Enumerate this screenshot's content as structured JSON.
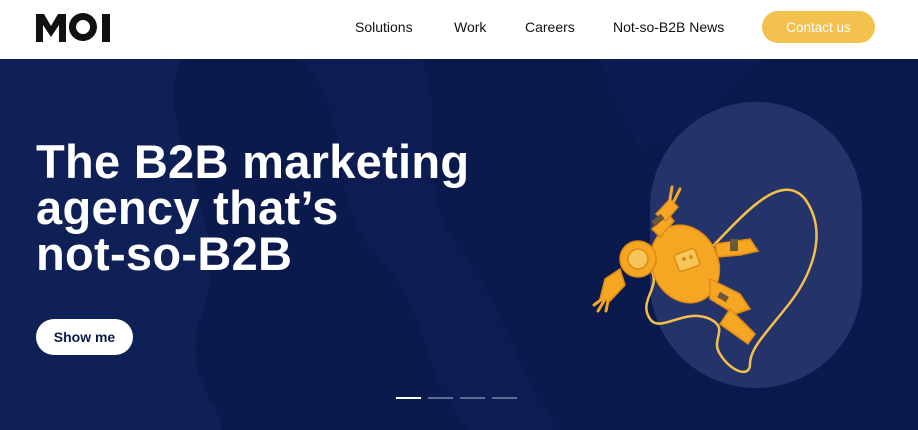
{
  "header": {
    "logo_text": "MOI",
    "nav": [
      "Solutions",
      "Work",
      "Careers",
      "Not-so-B2B News"
    ],
    "contact_label": "Contact us"
  },
  "hero": {
    "headline": [
      "The B2B marketing",
      "agency that’s",
      "not-so-B2B"
    ],
    "cta_label": "Show me",
    "slides": {
      "count": 4,
      "active": 1
    }
  },
  "colors": {
    "accent": "#f2c14e",
    "hero_bg": "#0b1a4d",
    "pill": "#24346b",
    "astronaut": "#f5a623"
  },
  "icons": [
    "moi-logo",
    "astronaut-illustration"
  ]
}
